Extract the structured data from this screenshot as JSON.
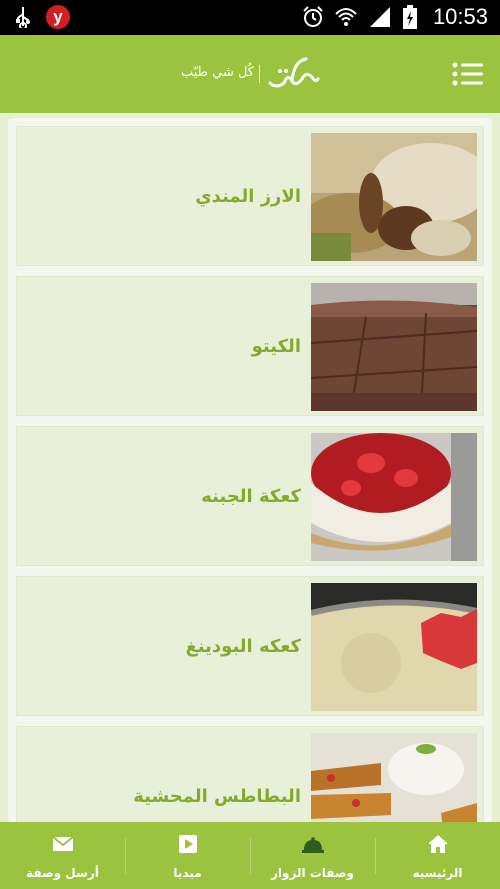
{
  "status_bar": {
    "time": "10:53",
    "badge_letter": "y",
    "icons": [
      "usb-icon",
      "alarm-icon",
      "wifi-icon",
      "signal-icon",
      "battery-icon"
    ]
  },
  "app_bar": {
    "slogan": "كُل شي طيّب",
    "menu_icon": "list-menu-icon"
  },
  "recipes": [
    {
      "title": "الارز المندي",
      "image": "mandi-rice"
    },
    {
      "title": "الكيتو",
      "image": "keto-cake"
    },
    {
      "title": "كعكة الجبنه",
      "image": "cheesecake"
    },
    {
      "title": "كعكه البودينغ",
      "image": "pudding-cake"
    },
    {
      "title": "البطاطس المحشية",
      "image": "stuffed-potatoes"
    }
  ],
  "bottom_nav": [
    {
      "label": "الرئيسيه",
      "icon": "home-icon"
    },
    {
      "label": "وصفات الزوار",
      "icon": "cloche-icon"
    },
    {
      "label": "ميديا",
      "icon": "play-icon"
    },
    {
      "label": "أرسل وصفة",
      "icon": "mail-icon"
    }
  ],
  "colors": {
    "primary": "#9bc33f",
    "title_text": "#85a92c",
    "background": "#e6efd2"
  }
}
